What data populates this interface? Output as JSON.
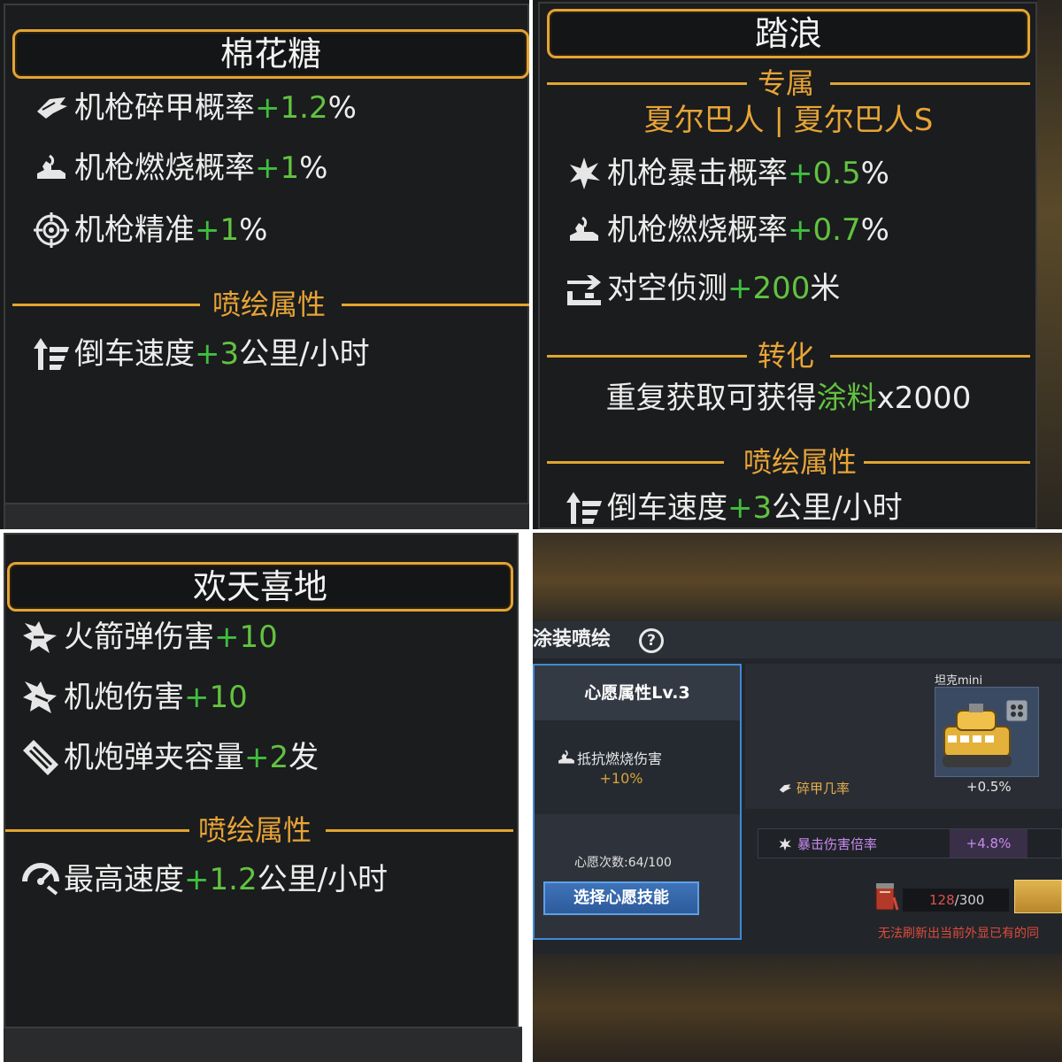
{
  "colors": {
    "gold": "#e3a333",
    "green": "#3fbf3f",
    "white": "#ededed",
    "purple": "#c78bee",
    "red": "#e04a3a"
  },
  "panel1": {
    "title": "棉花糖",
    "stats": [
      {
        "icon": "armor-break-icon",
        "label": "机枪碎甲概率",
        "plus": "+",
        "value": "1.2",
        "unit": "%"
      },
      {
        "icon": "burn-icon",
        "label": "机枪燃烧概率",
        "plus": "+",
        "value": "1",
        "unit": "%"
      },
      {
        "icon": "crosshair-icon",
        "label": "机枪精准",
        "plus": "+",
        "value": "1",
        "unit": "%"
      }
    ],
    "section_label": "喷绘属性",
    "paint_stat": {
      "icon": "reverse-speed-icon",
      "label": "倒车速度",
      "plus": "+",
      "value": "3",
      "unit": "公里/小时"
    }
  },
  "panel2": {
    "title": "踏浪",
    "exclusive_label": "专属",
    "exclusive_for": "夏尔巴人 | 夏尔巴人S",
    "stats": [
      {
        "icon": "crit-icon",
        "label": "机枪暴击概率",
        "plus": "+",
        "value": "0.5",
        "unit": "%"
      },
      {
        "icon": "burn-icon",
        "label": "机枪燃烧概率",
        "plus": "+",
        "value": "0.7",
        "unit": "%"
      },
      {
        "icon": "air-detect-icon",
        "label": "对空侦测",
        "plus": "+",
        "value": "200",
        "unit": "米"
      }
    ],
    "convert_label": "转化",
    "convert_text_a": "重复获取可获得",
    "convert_text_b": "涂料",
    "convert_text_c": "x2000",
    "section_label": "喷绘属性",
    "paint_stat": {
      "icon": "reverse-speed-icon",
      "label": "倒车速度",
      "plus": "+",
      "value": "3",
      "unit": "公里/小时"
    }
  },
  "panel3": {
    "title": "欢天喜地",
    "stats": [
      {
        "icon": "rocket-icon",
        "label": "火箭弹伤害",
        "plus": "+",
        "value": "10",
        "unit": ""
      },
      {
        "icon": "cannon-icon",
        "label": "机炮伤害",
        "plus": "+",
        "value": "10",
        "unit": ""
      },
      {
        "icon": "magazine-icon",
        "label": "机炮弹夹容量",
        "plus": "+",
        "value": "2",
        "unit": "发"
      }
    ],
    "section_label": "喷绘属性",
    "paint_stat": {
      "icon": "top-speed-icon",
      "label": "最高速度",
      "plus": "+",
      "value": "1.2",
      "unit": "公里/小时"
    }
  },
  "panel4": {
    "header_title": "涂装喷绘",
    "help_glyph": "?",
    "wish_level": "心愿属性Lv.3",
    "resist_label": "抵抗燃烧伤害",
    "resist_value": "+10%",
    "wish_count": "心愿次数:64/100",
    "choose_button": "选择心愿技能",
    "tank_name": "坦克mini",
    "armor_label": "碎甲几率",
    "armor_value": "+0.5%",
    "crit_label": "暴击伤害倍率",
    "crit_value": "+4.8%",
    "paint_current": "128",
    "paint_max": "/300",
    "warning": "无法刷新出当前外显已有的同"
  }
}
